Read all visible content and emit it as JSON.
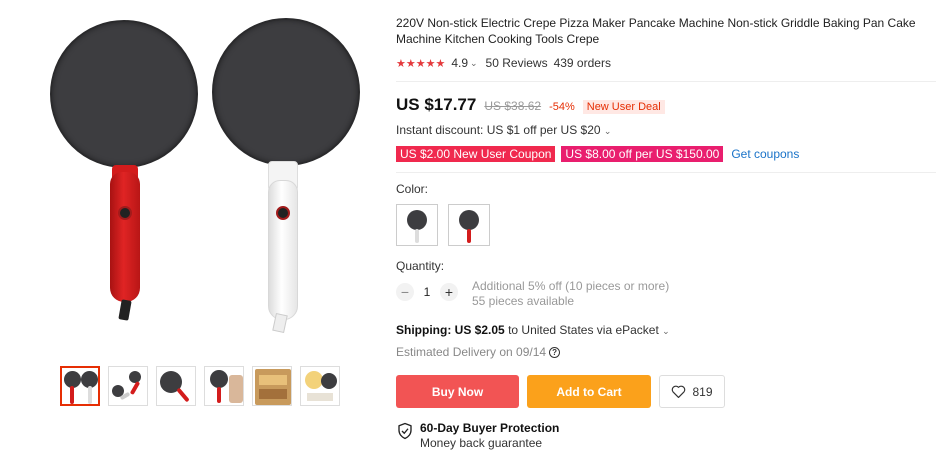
{
  "product": {
    "title": "220V Non-stick Electric Crepe Pizza Maker Pancake Machine Non-stick Griddle Baking Pan Cake Machine Kitchen Cooking Tools Crepe",
    "rating": "4.9",
    "reviews": "50 Reviews",
    "orders": "439 orders",
    "stars": "★★★★★"
  },
  "pricing": {
    "price": "US $17.77",
    "original": "US $38.62",
    "discount": "-54%",
    "deal_badge": "New User Deal",
    "instant_discount": "Instant discount: US $1 off per US $20",
    "coupons": [
      "US $2.00 New User Coupon",
      "US $8.00 off per US $150.00"
    ],
    "get_coupons": "Get coupons"
  },
  "color": {
    "label": "Color:",
    "options": [
      "black-white",
      "black-red"
    ]
  },
  "quantity": {
    "label": "Quantity:",
    "minus": "−",
    "value": "1",
    "plus": "+",
    "note_discount": "Additional 5% off (10 pieces or more)",
    "note_available": "55 pieces available"
  },
  "shipping": {
    "label": "Shipping:",
    "cost": "US $2.05",
    "destination": "to United States via ePacket",
    "delivery": "Estimated Delivery on 09/14",
    "help_icon": "?"
  },
  "actions": {
    "buy_now": "Buy Now",
    "add_to_cart": "Add to Cart",
    "wishlist_count": "819"
  },
  "protection": {
    "title": "60-Day Buyer Protection",
    "subtitle": "Money back guarantee"
  },
  "colors": {
    "accent_red": "#e62e04",
    "buy_button": "#f25454",
    "cart_button": "#fba11b",
    "coupon_red": "#f0294e",
    "link_blue": "#1a73c8"
  }
}
